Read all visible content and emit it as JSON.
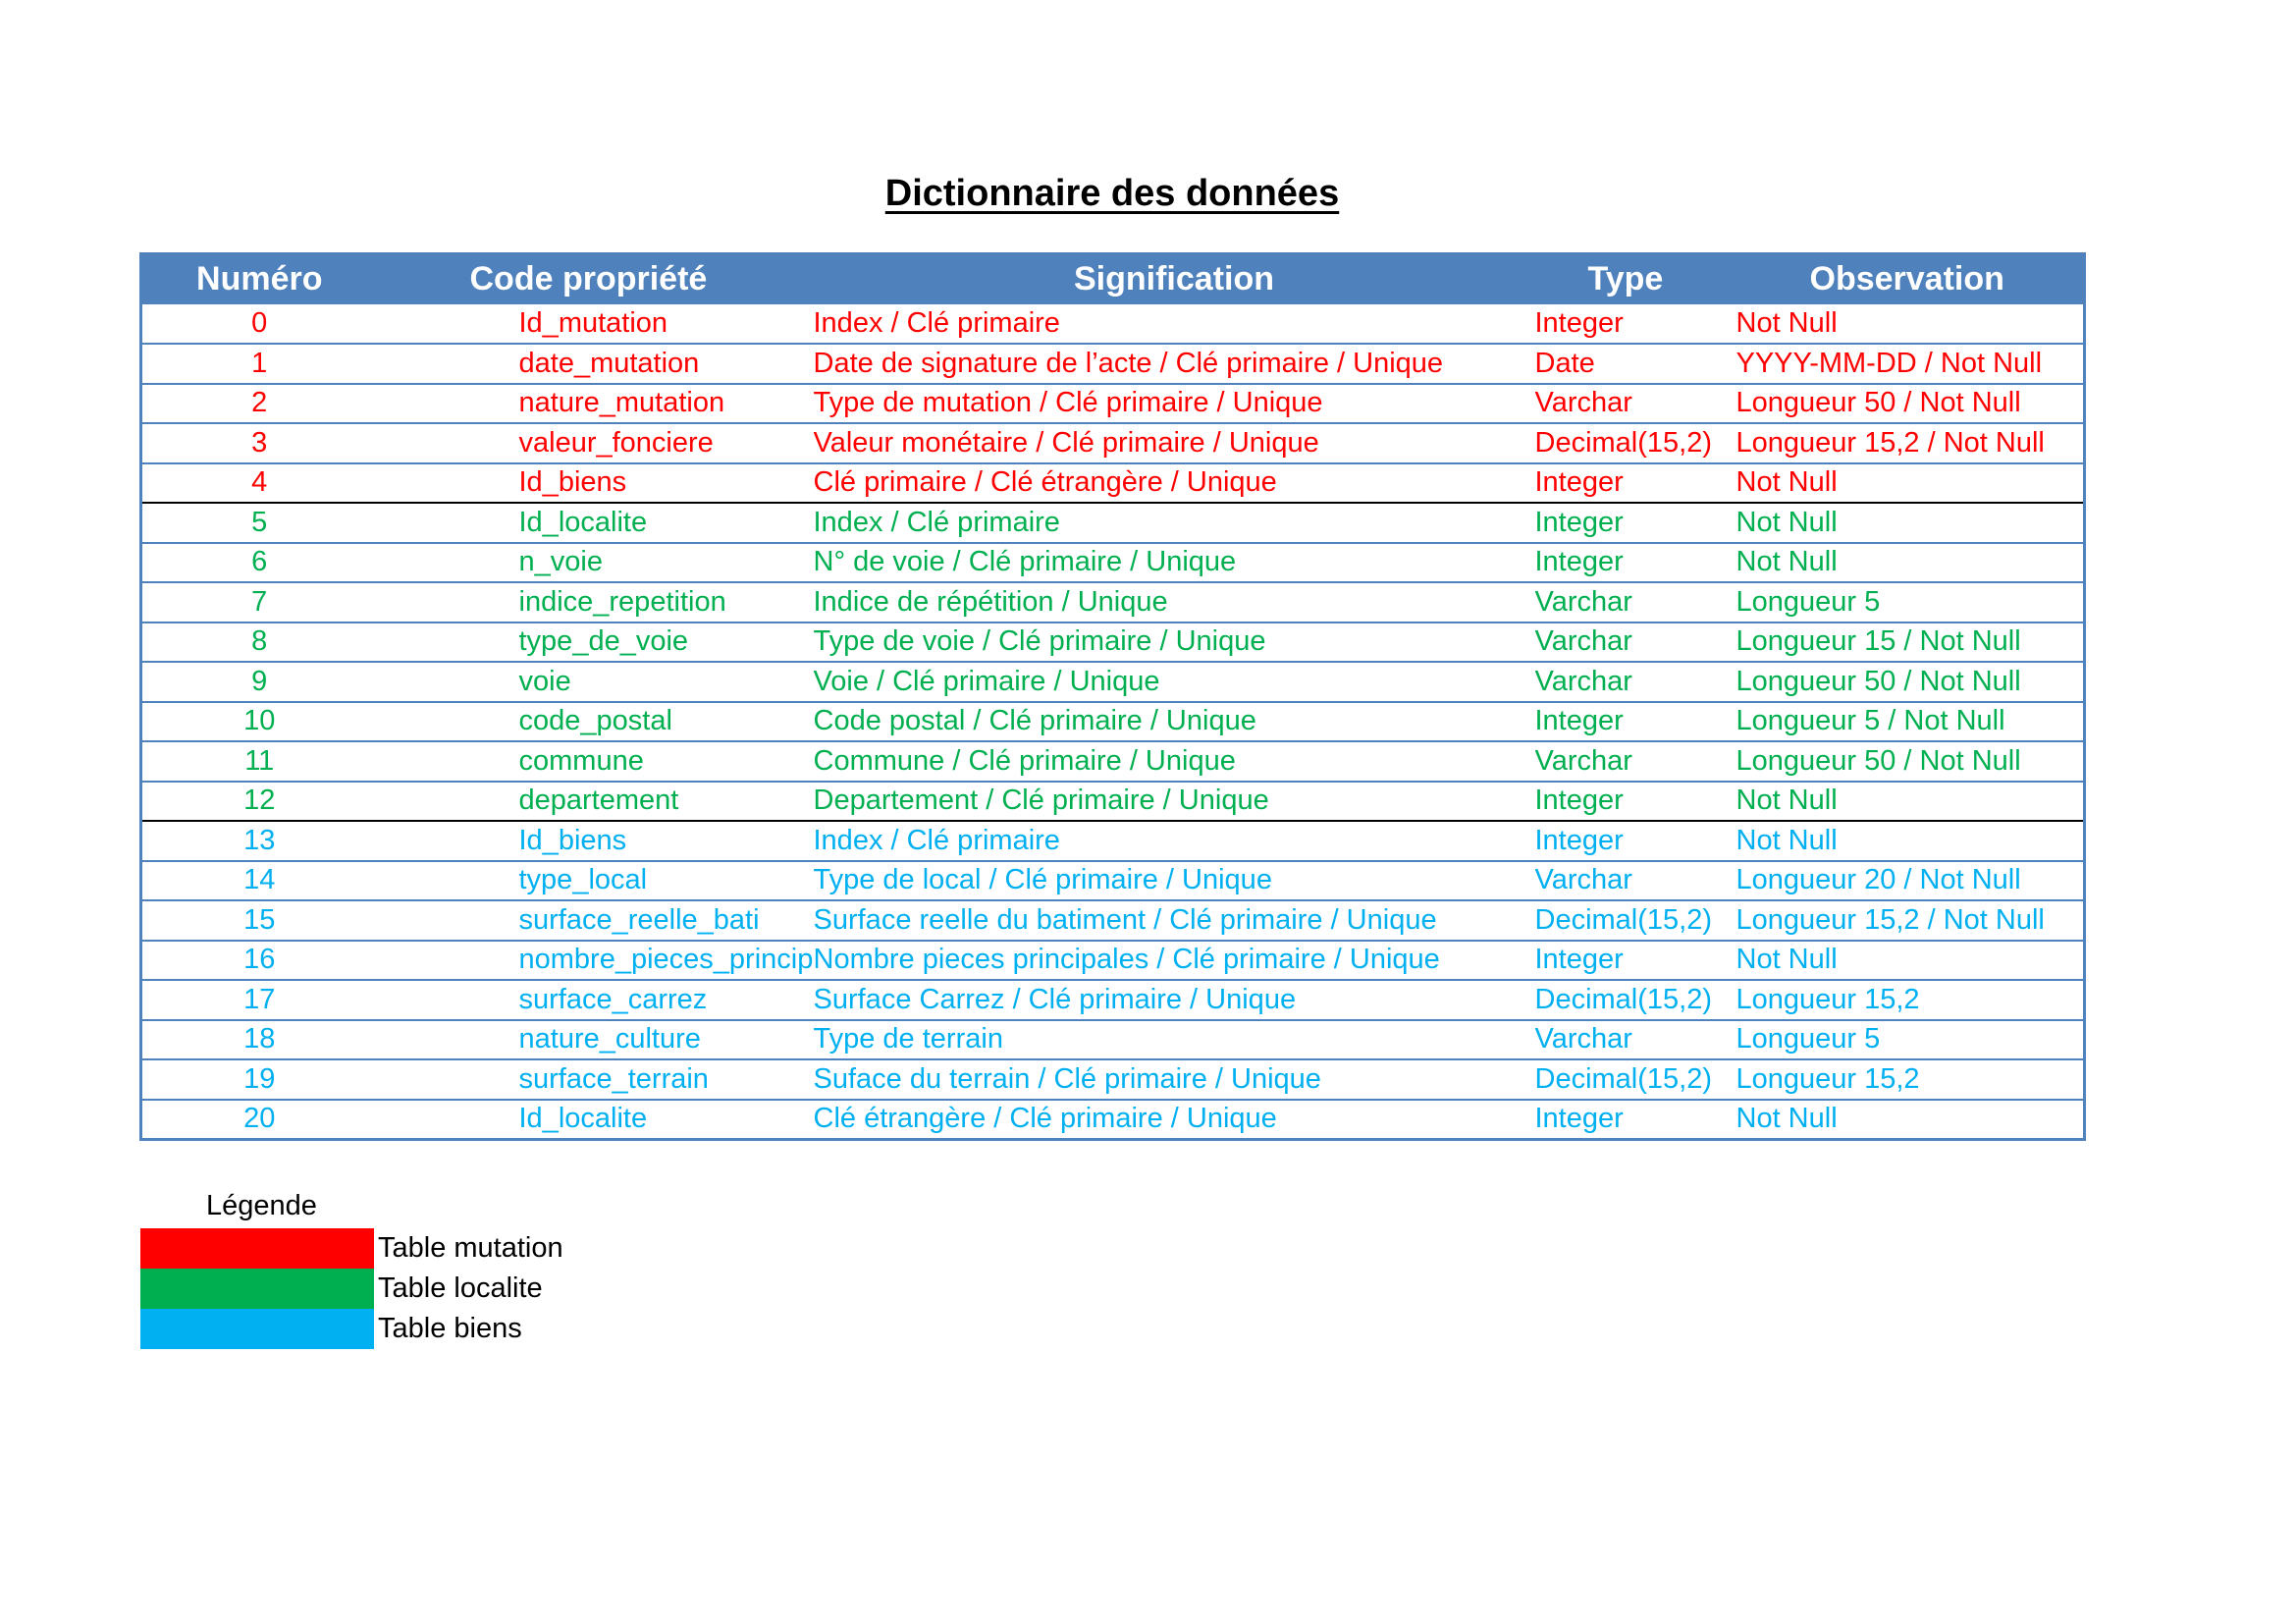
{
  "title": "Dictionnaire des données",
  "colors": {
    "header_bg": "#4f81bd",
    "mutation": "#ff0000",
    "localite": "#00b050",
    "biens": "#00b0f0"
  },
  "table": {
    "headers": {
      "numero": "Numéro",
      "code": "Code  propriété",
      "signification": "Signification",
      "type": "Type",
      "observation": "Observation"
    },
    "rows": [
      {
        "num": "0",
        "code": "Id_mutation",
        "sig": "Index / Clé primaire",
        "type": "Integer",
        "obs": "Not Null",
        "group": "mutation"
      },
      {
        "num": "1",
        "code": "date_mutation",
        "sig": "Date de signature de l’acte / Clé primaire / Unique",
        "type": "Date",
        "obs": "YYYY-MM-DD / Not Null",
        "group": "mutation"
      },
      {
        "num": "2",
        "code": "nature_mutation",
        "sig": "Type de mutation / Clé primaire / Unique",
        "type": "Varchar",
        "obs": "Longueur 50 / Not Null",
        "group": "mutation"
      },
      {
        "num": "3",
        "code": "valeur_fonciere",
        "sig": "Valeur monétaire / Clé primaire / Unique",
        "type": "Decimal(15,2)",
        "obs": "Longueur 15,2 / Not Null",
        "group": "mutation"
      },
      {
        "num": "4",
        "code": "Id_biens",
        "sig": "Clé primaire / Clé étrangère / Unique",
        "type": "Integer",
        "obs": "Not Null",
        "group": "mutation"
      },
      {
        "num": "5",
        "code": "Id_localite",
        "sig": "Index / Clé primaire",
        "type": "Integer",
        "obs": "Not Null",
        "group": "localite"
      },
      {
        "num": "6",
        "code": "n_voie",
        "sig": "N° de voie / Clé primaire / Unique",
        "type": "Integer",
        "obs": "Not Null",
        "group": "localite"
      },
      {
        "num": "7",
        "code": "indice_repetition",
        "sig": "Indice de répétition / Unique",
        "type": "Varchar",
        "obs": "Longueur 5",
        "group": "localite"
      },
      {
        "num": "8",
        "code": "type_de_voie",
        "sig": "Type de voie / Clé primaire / Unique",
        "type": "Varchar",
        "obs": "Longueur 15 / Not Null",
        "group": "localite"
      },
      {
        "num": "9",
        "code": "voie",
        "sig": "Voie / Clé primaire / Unique",
        "type": "Varchar",
        "obs": "Longueur 50 / Not Null",
        "group": "localite"
      },
      {
        "num": "10",
        "code": "code_postal",
        "sig": "Code postal / Clé primaire / Unique",
        "type": "Integer",
        "obs": "Longueur 5 / Not Null",
        "group": "localite"
      },
      {
        "num": "11",
        "code": "commune",
        "sig": "Commune / Clé primaire / Unique",
        "type": "Varchar",
        "obs": "Longueur 50 / Not Null",
        "group": "localite"
      },
      {
        "num": "12",
        "code": "departement",
        "sig": "Departement / Clé primaire / Unique",
        "type": "Integer",
        "obs": "Not Null",
        "group": "localite"
      },
      {
        "num": "13",
        "code": "Id_biens",
        "sig": "Index / Clé primaire",
        "type": "Integer",
        "obs": "Not Null",
        "group": "biens"
      },
      {
        "num": "14",
        "code": "type_local",
        "sig": "Type de local / Clé primaire / Unique",
        "type": "Varchar",
        "obs": "Longueur 20 / Not Null",
        "group": "biens"
      },
      {
        "num": "15",
        "code": "surface_reelle_bati",
        "sig": "Surface reelle du batiment / Clé primaire / Unique",
        "type": "Decimal(15,2)",
        "obs": "Longueur 15,2 / Not Null",
        "group": "biens"
      },
      {
        "num": "16",
        "code": "nombre_pieces_principales",
        "sig": "Nombre pieces principales / Clé primaire / Unique",
        "type": "Integer",
        "obs": "Not Null",
        "group": "biens"
      },
      {
        "num": "17",
        "code": "surface_carrez",
        "sig": "Surface Carrez / Clé primaire / Unique",
        "type": "Decimal(15,2)",
        "obs": "Longueur 15,2",
        "group": "biens"
      },
      {
        "num": "18",
        "code": "nature_culture",
        "sig": "Type de terrain",
        "type": "Varchar",
        "obs": "Longueur 5",
        "group": "biens"
      },
      {
        "num": "19",
        "code": "surface_terrain",
        "sig": "Suface du terrain / Clé primaire / Unique",
        "type": "Decimal(15,2)",
        "obs": "Longueur 15,2",
        "group": "biens"
      },
      {
        "num": "20",
        "code": "Id_localite",
        "sig": "Clé étrangère / Clé primaire / Unique",
        "type": "Integer",
        "obs": "Not Null",
        "group": "biens"
      }
    ]
  },
  "legend": {
    "title": "Légende",
    "items": [
      {
        "label": "Table mutation",
        "group": "mutation"
      },
      {
        "label": "Table localite",
        "group": "localite"
      },
      {
        "label": "Table biens",
        "group": "biens"
      }
    ]
  }
}
